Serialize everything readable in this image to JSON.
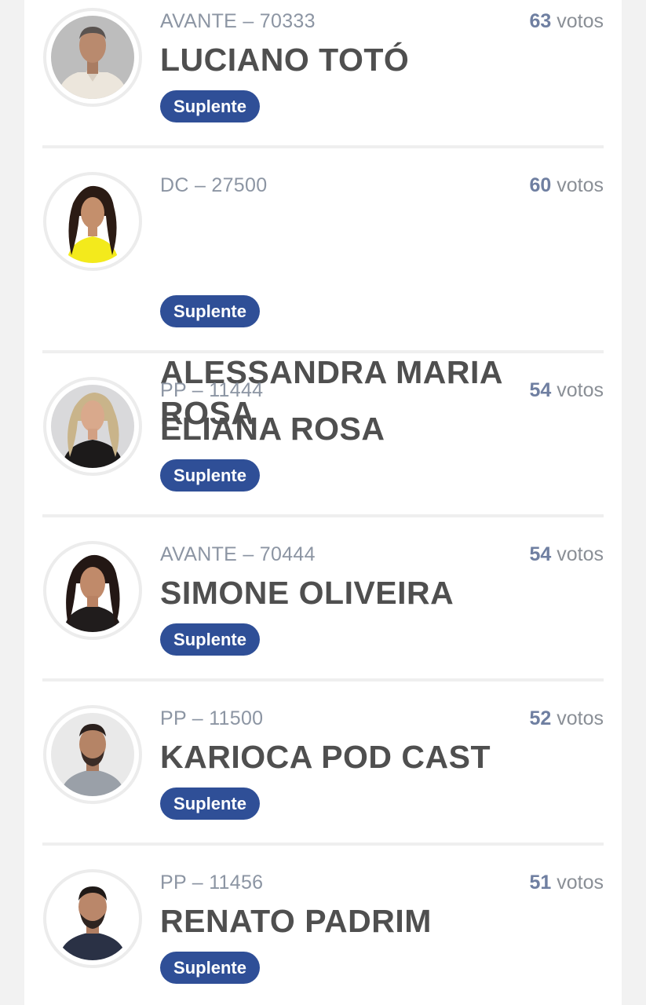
{
  "candidates": [
    {
      "party": "AVANTE – 70333",
      "name": "LUCIANO TOTÓ",
      "votes": "63",
      "votes_unit": "votos",
      "status": "Suplente",
      "photo": "candidate-photo-man-white-shirt"
    },
    {
      "party": "DC – 27500",
      "name": "ALESSANDRA MARIA ROSA",
      "votes": "60",
      "votes_unit": "votos",
      "status": "Suplente",
      "photo": "candidate-photo-woman-yellow-top"
    },
    {
      "party": "PP – 11444",
      "name": "ELIANA ROSA",
      "votes": "54",
      "votes_unit": "votos",
      "status": "Suplente",
      "photo": "candidate-photo-woman-blonde-black-top"
    },
    {
      "party": "AVANTE – 70444",
      "name": "SIMONE OLIVEIRA",
      "votes": "54",
      "votes_unit": "votos",
      "status": "Suplente",
      "photo": "candidate-photo-woman-dark-hair"
    },
    {
      "party": "PP – 11500",
      "name": "KARIOCA POD CAST",
      "votes": "52",
      "votes_unit": "votos",
      "status": "Suplente",
      "photo": "candidate-photo-man-beard-gray-shirt"
    },
    {
      "party": "PP – 11456",
      "name": "RENATO PADRIM",
      "votes": "51",
      "votes_unit": "votos",
      "status": "Suplente",
      "photo": "candidate-photo-man-beard-dark-shirt"
    }
  ],
  "colors": {
    "badge": "#2f4f97",
    "vote_count": "#6f7fa1",
    "name": "#4f4f4f",
    "party": "#8c95a3"
  }
}
